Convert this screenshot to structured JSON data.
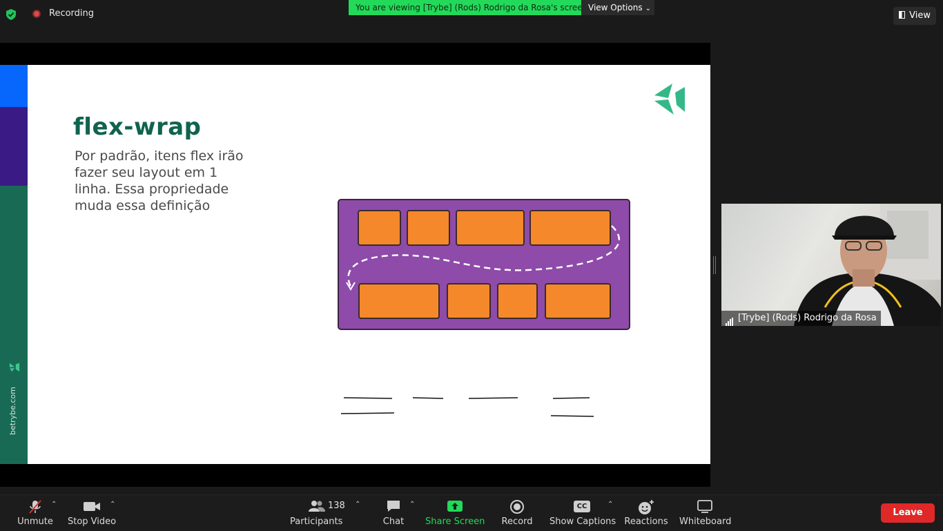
{
  "topbar": {
    "recording_label": "Recording",
    "viewing_banner": "You are viewing [Trybe]  (Rods) Rodrigo da Rosa's screen",
    "view_options_label": "View Options",
    "view_label": "View"
  },
  "slide": {
    "title": "flex-wrap",
    "body": "Por padrão, itens flex irão fazer seu layout em 1 linha. Essa propriedade muda essa definição",
    "site": "betrybe.com"
  },
  "participant": {
    "name": "[Trybe]  (Rods) Rodrigo da Rosa"
  },
  "toolbar": {
    "unmute": "Unmute",
    "stop_video": "Stop Video",
    "participants": "Participants",
    "participants_count": "138",
    "chat": "Chat",
    "share_screen": "Share Screen",
    "record": "Record",
    "show_captions": "Show Captions",
    "cc_badge": "CC",
    "reactions": "Reactions",
    "whiteboard": "Whiteboard",
    "leave": "Leave"
  },
  "colors": {
    "share_green": "#23d959",
    "leave_red": "#e02828",
    "trybe_green": "#10634f",
    "box_purple": "#8e4ba9",
    "item_orange": "#f5882b"
  }
}
